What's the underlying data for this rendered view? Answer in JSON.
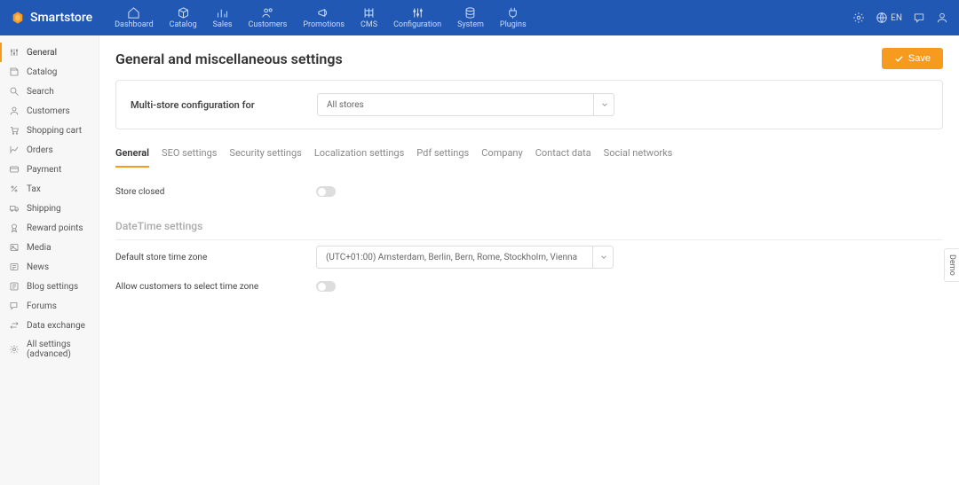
{
  "brand": "Smartstore",
  "topnav": [
    {
      "label": "Dashboard"
    },
    {
      "label": "Catalog"
    },
    {
      "label": "Sales"
    },
    {
      "label": "Customers"
    },
    {
      "label": "Promotions"
    },
    {
      "label": "CMS"
    },
    {
      "label": "Configuration"
    },
    {
      "label": "System"
    },
    {
      "label": "Plugins"
    }
  ],
  "lang": "EN",
  "sidebar": [
    {
      "label": "General",
      "active": true
    },
    {
      "label": "Catalog"
    },
    {
      "label": "Search"
    },
    {
      "label": "Customers"
    },
    {
      "label": "Shopping cart"
    },
    {
      "label": "Orders"
    },
    {
      "label": "Payment"
    },
    {
      "label": "Tax"
    },
    {
      "label": "Shipping"
    },
    {
      "label": "Reward points"
    },
    {
      "label": "Media"
    },
    {
      "label": "News"
    },
    {
      "label": "Blog settings"
    },
    {
      "label": "Forums"
    },
    {
      "label": "Data exchange"
    },
    {
      "label": "All settings (advanced)"
    }
  ],
  "page": {
    "title": "General and miscellaneous settings",
    "save_label": "Save"
  },
  "multistore": {
    "label": "Multi-store configuration for",
    "value": "All stores"
  },
  "tabs": [
    {
      "label": "General",
      "active": true
    },
    {
      "label": "SEO settings"
    },
    {
      "label": "Security settings"
    },
    {
      "label": "Localization settings"
    },
    {
      "label": "Pdf settings"
    },
    {
      "label": "Company"
    },
    {
      "label": "Contact data"
    },
    {
      "label": "Social networks"
    }
  ],
  "fields": {
    "store_closed_label": "Store closed",
    "store_closed_value": false,
    "datetime_heading": "DateTime settings",
    "tz_label": "Default store time zone",
    "tz_value": "(UTC+01:00) Amsterdam, Berlin, Bern, Rome, Stockholm, Vienna",
    "allow_tz_label": "Allow customers to select time zone",
    "allow_tz_value": false
  },
  "demo_label": "Demo"
}
